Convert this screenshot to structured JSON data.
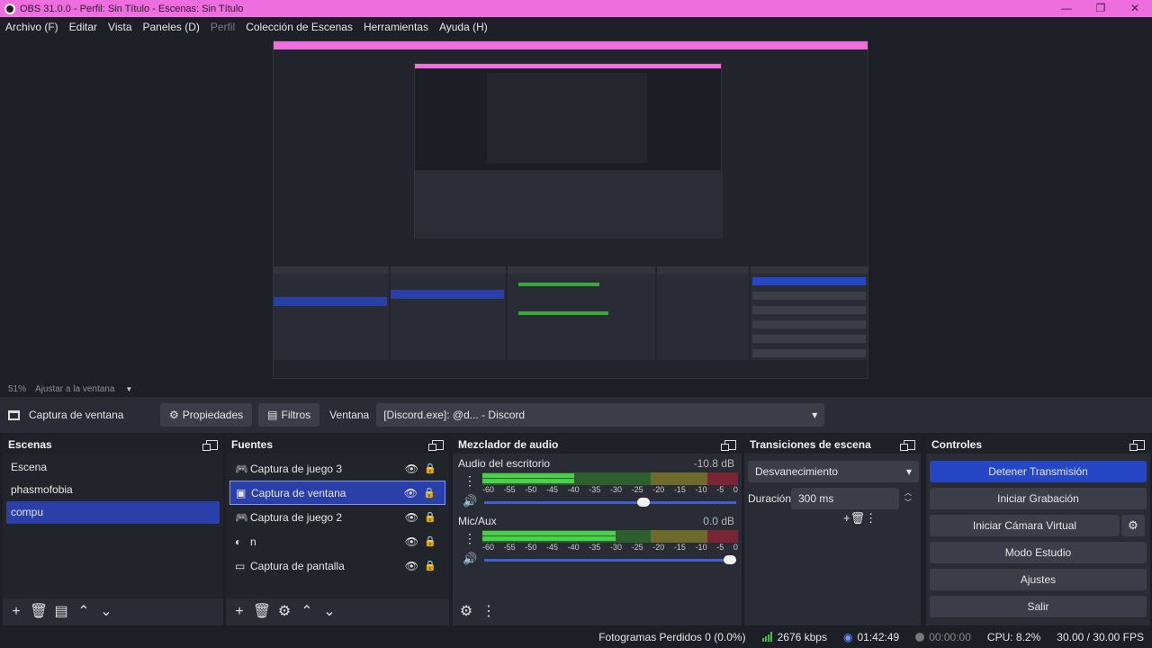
{
  "window": {
    "title": "OBS 31.0.0 - Perfil: Sin Título - Escenas: Sin Título",
    "controls": [
      "—",
      "❐",
      "✕"
    ]
  },
  "menu": [
    {
      "label": "Archivo (F)",
      "enabled": true
    },
    {
      "label": "Editar",
      "enabled": true
    },
    {
      "label": "Vista",
      "enabled": true
    },
    {
      "label": "Paneles (D)",
      "enabled": true
    },
    {
      "label": "Perfil",
      "enabled": false
    },
    {
      "label": "Colección de Escenas",
      "enabled": true
    },
    {
      "label": "Herramientas",
      "enabled": true
    },
    {
      "label": "Ayuda (H)",
      "enabled": true
    }
  ],
  "zoom": {
    "percent": "51%",
    "label": "Ajustar a la ventana"
  },
  "source_toolbar": {
    "selected_source": "Captura de ventana",
    "properties_label": "Propiedades",
    "filters_label": "Filtros",
    "window_label": "Ventana",
    "window_value": "[Discord.exe]: @d... - Discord"
  },
  "scenes": {
    "title": "Escenas",
    "items": [
      "Escena",
      "phasmofobia",
      "compu"
    ],
    "selected_index": 2
  },
  "sources": {
    "title": "Fuentes",
    "items": [
      {
        "label": "Captura de juego 3",
        "icon": "gamepad-icon",
        "selected": false
      },
      {
        "label": "Captura de ventana",
        "icon": "window-icon",
        "selected": true
      },
      {
        "label": "Captura de juego 2",
        "icon": "gamepad-icon",
        "selected": false
      },
      {
        "label": "n",
        "icon": "browser-icon",
        "selected": false
      },
      {
        "label": "Captura de pantalla",
        "icon": "monitor-icon",
        "selected": false
      }
    ]
  },
  "mixer": {
    "title": "Mezclador de audio",
    "channels": [
      {
        "name": "Audio del escritorio",
        "db": "-10.8 dB",
        "level": 0.36,
        "volume": 0.64
      },
      {
        "name": "Mic/Aux",
        "db": "0.0 dB",
        "level": 0.52,
        "volume": 1.0
      }
    ],
    "ticks": [
      "-60",
      "-55",
      "-50",
      "-45",
      "-40",
      "-35",
      "-30",
      "-25",
      "-20",
      "-15",
      "-10",
      "-5",
      "0"
    ]
  },
  "transitions": {
    "title": "Transiciones de escena",
    "selected": "Desvanecimiento",
    "duration_label": "Duración",
    "duration_value": "300 ms"
  },
  "controls": {
    "title": "Controles",
    "buttons": [
      "Detener Transmisión",
      "Iniciar Grabación",
      "Iniciar Cámara Virtual",
      "Modo Estudio",
      "Ajustes",
      "Salir"
    ]
  },
  "status": {
    "dropped": "Fotogramas Perdidos 0 (0.0%)",
    "bitrate": "2676 kbps",
    "stream_time": "01:42:49",
    "rec_time": "00:00:00",
    "cpu": "CPU: 8.2%",
    "fps": "30.00 / 30.00 FPS"
  },
  "colors": {
    "titlebar": "#ee6ee0",
    "accent": "#2547c6",
    "selection": "#2a3fa8"
  }
}
